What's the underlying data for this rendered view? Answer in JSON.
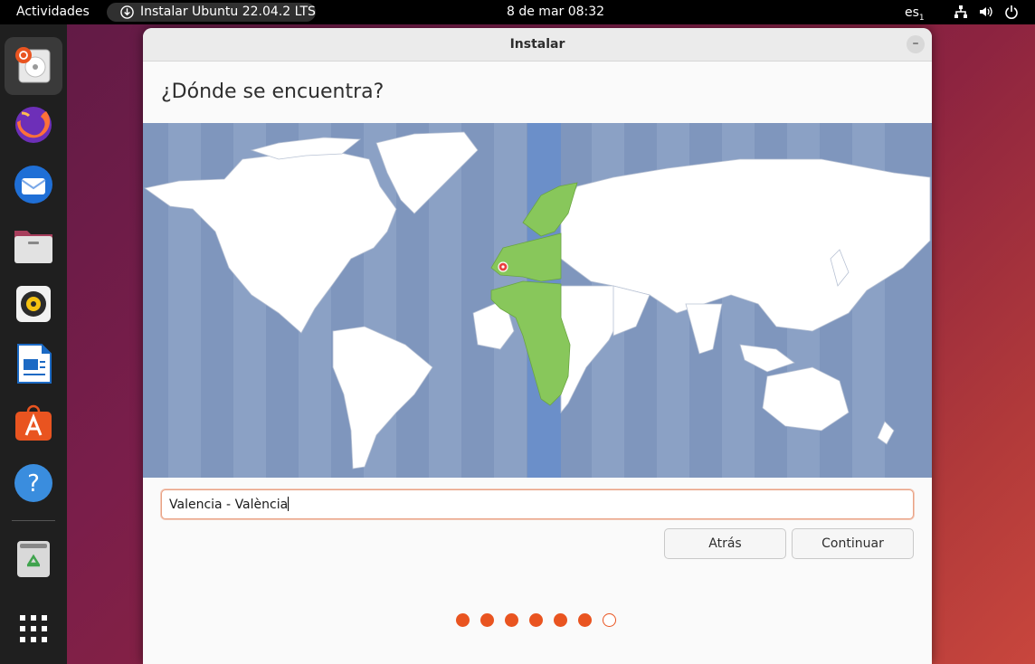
{
  "topbar": {
    "activities": "Actividades",
    "app_label": "Instalar Ubuntu 22.04.2 LTS",
    "clock": "8 de mar  08:32",
    "keyboard": "es",
    "keyboard_sub": "1"
  },
  "dock": {
    "items": [
      "ubuntu-installer",
      "firefox",
      "thunderbird",
      "files",
      "rhythmbox",
      "libreoffice-writer",
      "app-center",
      "help",
      "trash",
      "show-apps"
    ]
  },
  "window": {
    "title": "Instalar",
    "minimize_symbol": "–",
    "heading": "¿Dónde se encuentra?",
    "location_value": "Valencia - València",
    "back_label": "Atrás",
    "continue_label": "Continuar",
    "progress": {
      "total": 7,
      "completed": 6
    }
  },
  "colors": {
    "accent": "#e95420",
    "map_ocean": "#7f96bd",
    "map_land": "#ffffff",
    "map_highlight_land": "#88c75b",
    "map_highlight_band": "#6b8fc9"
  }
}
